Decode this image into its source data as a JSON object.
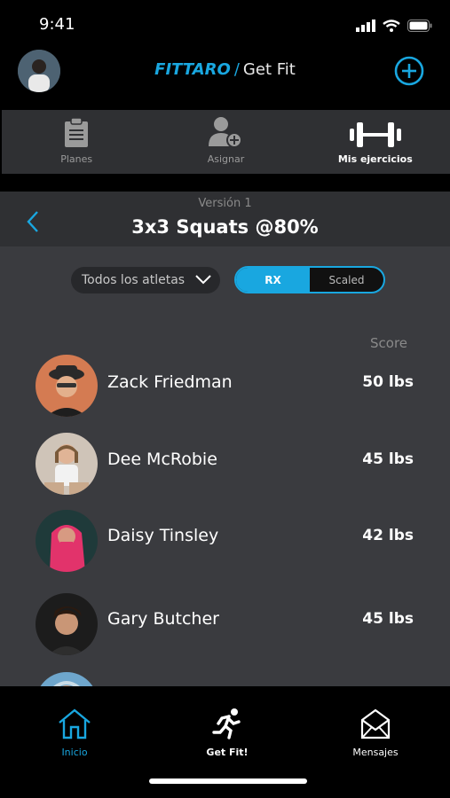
{
  "status": {
    "time": "9:41"
  },
  "header": {
    "brand": "FITTARO",
    "separator": "/",
    "section": "Get Fit"
  },
  "tabs": [
    {
      "label": "Planes",
      "icon": "clipboard-icon"
    },
    {
      "label": "Asignar",
      "icon": "add-person-icon"
    },
    {
      "label": "Mis ejercicios",
      "icon": "dumbbell-icon",
      "active": true
    }
  ],
  "exercise": {
    "version": "Versión 1",
    "title": "3x3 Squats @80%"
  },
  "filters": {
    "athletes": "Todos los atletas",
    "rx": "RX",
    "scaled": "Scaled"
  },
  "leaderboard": {
    "score_header": "Score",
    "rows": [
      {
        "name": "Zack Friedman",
        "score": "50 lbs"
      },
      {
        "name": "Dee McRobie",
        "score": "45 lbs"
      },
      {
        "name": "Daisy Tinsley",
        "score": "42 lbs"
      },
      {
        "name": "Gary Butcher",
        "score": "45 lbs"
      }
    ]
  },
  "bottom_nav": [
    {
      "label": "Inicio",
      "icon": "home-icon",
      "active": true
    },
    {
      "label": "Get Fit!",
      "icon": "runner-icon"
    },
    {
      "label": "Mensajes",
      "icon": "envelope-icon"
    }
  ],
  "colors": {
    "accent": "#19a7e0",
    "panel": "#3a3b3f",
    "bar": "#2f3033"
  }
}
